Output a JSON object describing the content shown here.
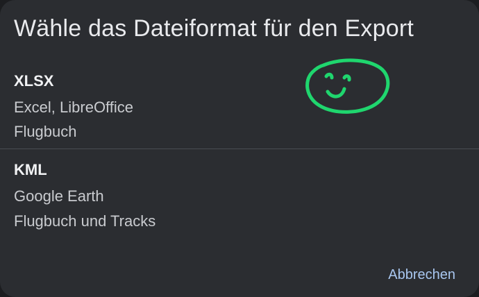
{
  "dialog": {
    "title": "Wähle das Dateiformat für den Export",
    "options": [
      {
        "title": "XLSX",
        "line1": "Excel, LibreOffice",
        "line2": "Flugbuch"
      },
      {
        "title": "KML",
        "line1": "Google Earth",
        "line2": "Flugbuch und Tracks"
      }
    ],
    "cancel_label": "Abbrechen"
  },
  "colors": {
    "dialog_background": "#2b2d31",
    "accent": "#a9c7f0",
    "doodle": "#1fd66e"
  },
  "icons": {
    "doodle": "smiley-face-icon"
  }
}
